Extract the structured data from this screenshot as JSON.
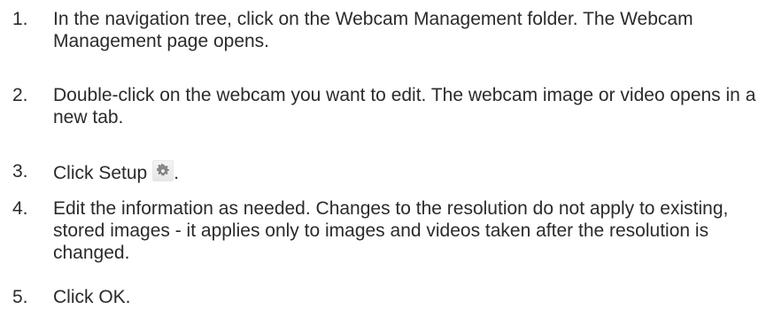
{
  "steps": [
    {
      "number": "1.",
      "text": "In the navigation tree, click on the Webcam Management folder. The Webcam Management page opens."
    },
    {
      "number": "2.",
      "text": "Double-click on the webcam you want to edit. The webcam image or video opens in a new tab."
    },
    {
      "number": "3.",
      "text": "Click Setup",
      "suffix": ".",
      "icon": "gear-icon"
    },
    {
      "number": "4.",
      "text": "Edit the information as needed. Changes to the resolution do not apply to existing, stored images - it applies only to images and videos taken after the resolution is changed."
    },
    {
      "number": "5.",
      "text": "Click OK."
    }
  ]
}
